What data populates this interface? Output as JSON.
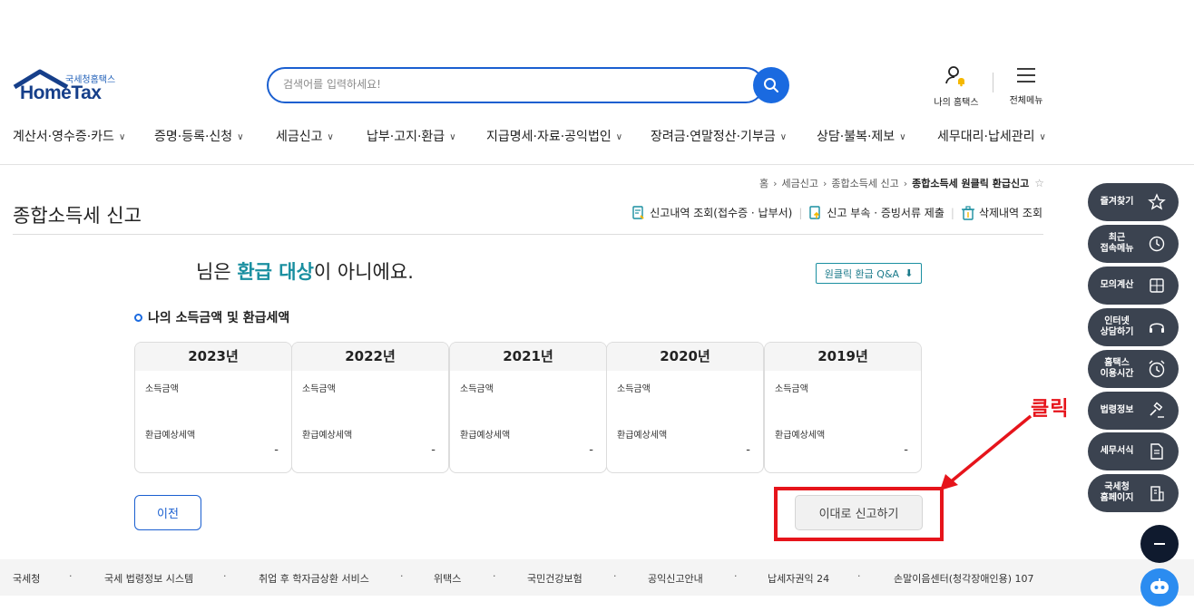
{
  "header": {
    "logo_sub": "국세청홈택스",
    "logo_main": "HomeTax",
    "search_placeholder": "검색어를 입력하세요!",
    "my_hometax": "나의 홈택스",
    "all_menu": "전체메뉴"
  },
  "nav": [
    "계산서·영수증·카드",
    "증명·등록·신청",
    "세금신고",
    "납부·고지·환급",
    "지급명세·자료·공익법인",
    "장려금·연말정산·기부금",
    "상담·불복·제보",
    "세무대리·납세관리"
  ],
  "breadcrumb": {
    "home": "홈",
    "level1": "세금신고",
    "level2": "종합소득세 신고",
    "current": "종합소득세 원클릭 환급신고"
  },
  "page": {
    "title": "종합소득세 신고",
    "quicklinks": [
      "신고내역 조회(접수증 · 납부서)",
      "신고 부속 · 증빙서류 제출",
      "삭제내역 조회"
    ],
    "notice_pre": "님은 ",
    "notice_hl": "환급 대상",
    "notice_post": "이 아니에요.",
    "qa_button": "원클릭 환급 Q&A",
    "section_title": "나의 소득금액 및 환급세액"
  },
  "years": [
    {
      "year": "2023년",
      "income_label": "소득금액",
      "refund_label": "환급예상세액",
      "refund_value": "-"
    },
    {
      "year": "2022년",
      "income_label": "소득금액",
      "refund_label": "환급예상세액",
      "refund_value": "-"
    },
    {
      "year": "2021년",
      "income_label": "소득금액",
      "refund_label": "환급예상세액",
      "refund_value": "-"
    },
    {
      "year": "2020년",
      "income_label": "소득금액",
      "refund_label": "환급예상세액",
      "refund_value": "-"
    },
    {
      "year": "2019년",
      "income_label": "소득금액",
      "refund_label": "환급예상세액",
      "refund_value": "-"
    }
  ],
  "buttons": {
    "prev": "이전",
    "report": "이대로 신고하기"
  },
  "annotation": {
    "label": "클릭",
    "color": "#e6141b"
  },
  "footer": [
    "국세청",
    "국세 법령정보 시스템",
    "취업 후 학자금상환 서비스",
    "위택스",
    "국민건강보험",
    "공익신고안내",
    "납세자권익 24",
    "손말이음센터(청각장애인용) 107"
  ],
  "side_menu": [
    {
      "label": "즐겨찾기",
      "icon": "star-icon"
    },
    {
      "label": "최근\n접속메뉴",
      "icon": "clock-icon"
    },
    {
      "label": "모의계산",
      "icon": "calculator-icon"
    },
    {
      "label": "인터넷\n상담하기",
      "icon": "headset-icon"
    },
    {
      "label": "홈택스\n이용시간",
      "icon": "alarm-icon"
    },
    {
      "label": "법령정보",
      "icon": "gavel-icon"
    },
    {
      "label": "세무서식",
      "icon": "document-icon"
    },
    {
      "label": "국세청\n홈페이지",
      "icon": "building-icon"
    }
  ],
  "colors": {
    "brand_blue": "#1a5fd0",
    "highlight_teal": "#1a8fa0",
    "side_menu_bg": "#3b4350"
  }
}
